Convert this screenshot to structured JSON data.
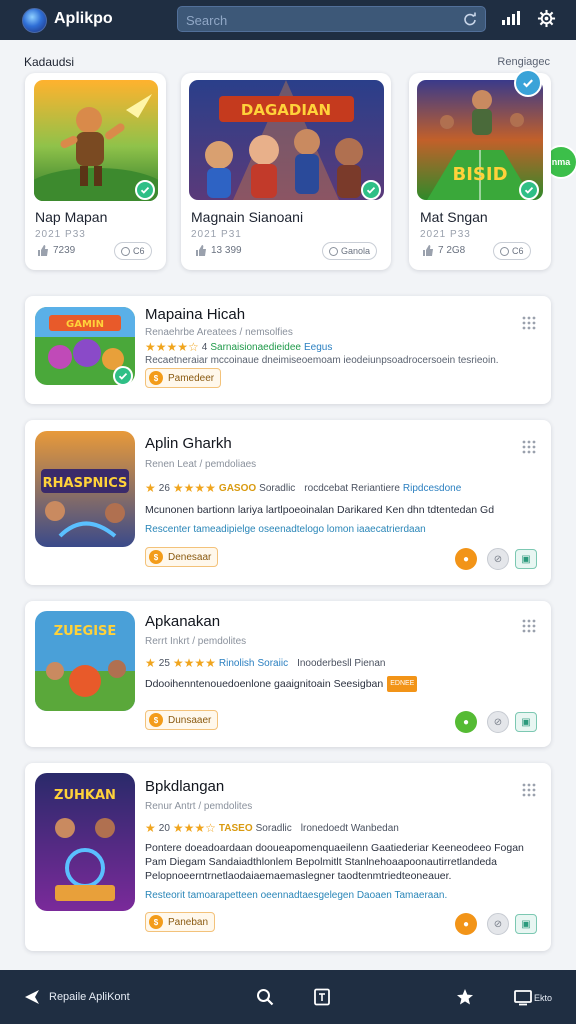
{
  "header": {
    "app_title": "Aplikpo",
    "search_placeholder": "Search",
    "icons": [
      "logo-icon",
      "refresh-icon",
      "signal-icon",
      "gear-icon"
    ]
  },
  "section": {
    "title": "Kadaudsi",
    "link": "Rengiagec"
  },
  "featured": [
    {
      "name": "Nap Mapan",
      "sub": "2021 P33",
      "likes": "7239",
      "pill": "C6",
      "banner": ""
    },
    {
      "name": "Magnain Sianoani",
      "sub": "2021 P31",
      "likes": "13 399",
      "pill": "Ganola",
      "banner": "DAGADIAN",
      "badge": "nma"
    },
    {
      "name": "Mat Sngan",
      "sub": "2021 P33",
      "likes": "7 2G8",
      "pill": "C6",
      "banner": "BISID"
    }
  ],
  "apps": [
    {
      "title": "Mapaina Hicah",
      "meta": "Renaehrbe   Areatees / nemsolfies",
      "rating_stars": 4,
      "rating_texts": [
        "4",
        "Sarnaisionaedieidee",
        "Eegus"
      ],
      "desc": "Recaetneraiar mccoinaue dneimiseoemoam ieodeiunpsoadrocersoein tesrieoin.",
      "desc2": "",
      "button": "Pamedeer",
      "thumb_text": "GAMIN",
      "actions": []
    },
    {
      "title": "Aplin Gharkh",
      "meta": "Renen   Leat / pemdoliaes",
      "rating_stars": 4,
      "rating_texts": [
        "26",
        "GASOO",
        "Soradlic",
        "rocdcebat Reriantiere",
        "Ripdcesdone"
      ],
      "desc": "Mcunonen bartionn lariya lartlpoeoinalan Darikared Ken dhn tdtentedan Gd",
      "desc2": "Rescenter tameadipielge oseenadtelogo lomon iaaecatrierdaan",
      "button": "Denesaar",
      "thumb_text": "RHASPNICS",
      "actions": [
        "orange",
        "grey",
        "square"
      ]
    },
    {
      "title": "Apkanakan",
      "meta": "Rerrt   Inkrt / pemdolites",
      "rating_stars": 4,
      "rating_texts": [
        "25",
        "Rinolish",
        "Soraiic",
        "Inooderbesll Pienan"
      ],
      "desc": "Ddooihenntenouedoenlone gaaignitoain Seesigban",
      "desc2": "",
      "tag": "EDNEE",
      "button": "Dunsaaer",
      "thumb_text": "ZUEGISE",
      "actions": [
        "lime",
        "grey",
        "square"
      ]
    },
    {
      "title": "Bpkdlangan",
      "meta": "Renur   Antrt / pemdolites",
      "rating_stars": 3,
      "rating_texts": [
        "20",
        "TASEO",
        "Soradlic",
        "lronedoedt Wanbedan"
      ],
      "desc": "Pontere doeadoardaan dooueapomenquaeilenn Gaatiederiar Keeneodeeo Fogan Pam Diegam Sandaiadthlonlem Bepolmitlt Stanlnehoaapoonautirretlandeda Pelopnoeerntrnetlaodaiaemaemaslegner taodtenmtriedteoneauer.",
      "desc2": "Resteorit tamoarapetteen oeennadtaesgelegen Daoaen Tamaeraan.",
      "button": "Paneban",
      "thumb_text": "ZUHKAN",
      "actions": [
        "orange",
        "grey",
        "square"
      ]
    }
  ],
  "bottom_nav": {
    "back_label": "Repaile ApliKont",
    "last_label": "Ekto",
    "icons": [
      "back-icon",
      "search-icon",
      "library-icon",
      "star-icon",
      "screen-icon"
    ]
  },
  "colors": {
    "topbar": "#1f2e42",
    "accent_orange": "#f29418",
    "accent_green": "#2fbf86",
    "rating_gold": "#f0a51e"
  }
}
